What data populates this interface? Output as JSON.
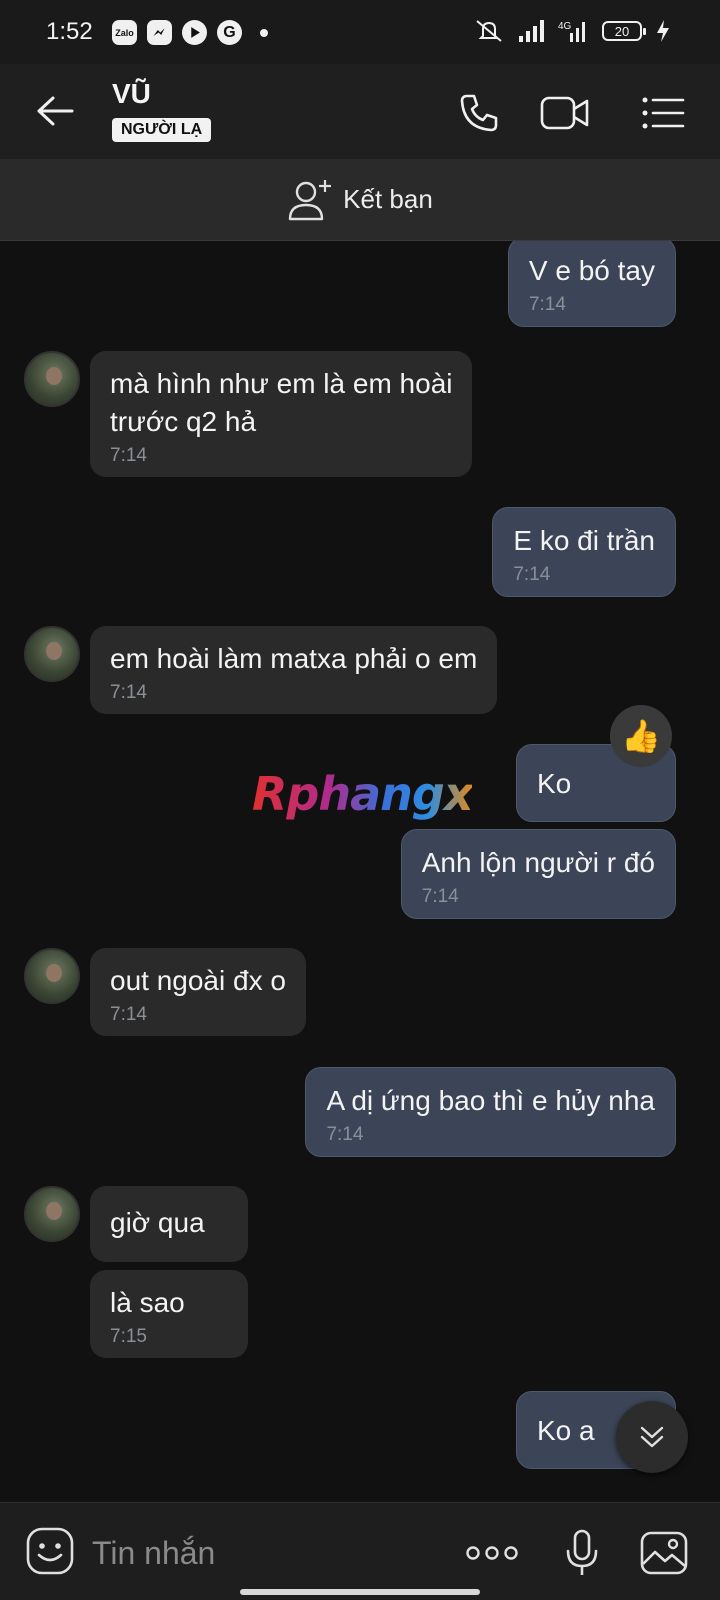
{
  "status_bar": {
    "time": "1:52",
    "apps": [
      "Zalo",
      "messenger-app",
      "youtube-app",
      "G"
    ],
    "network": "4G",
    "battery": "20"
  },
  "header": {
    "contact_name": "VŨ",
    "badge": "NGƯỜI LẠ",
    "icons": [
      "back-arrow-icon",
      "phone-icon",
      "video-icon",
      "menu-list-icon"
    ]
  },
  "add_friend": {
    "label": "Kết bạn"
  },
  "messages": [
    {
      "direction": "out",
      "text": "V e bó tay",
      "time": "7:14"
    },
    {
      "direction": "in",
      "text": "mà hình như em là em hoài\ntrước q2 hả",
      "time": "7:14"
    },
    {
      "direction": "out",
      "text": "E ko đi trần",
      "time": "7:14"
    },
    {
      "direction": "in",
      "text": "em hoài làm matxa phải o em",
      "time": "7:14"
    },
    {
      "direction": "out",
      "text": "Ko",
      "time": ""
    },
    {
      "direction": "out",
      "text": "Anh lộn người r đó",
      "time": "7:14"
    },
    {
      "direction": "in",
      "text": "out ngoài đx o",
      "time": "7:14"
    },
    {
      "direction": "out",
      "text": "A dị ứng bao thì e hủy nha",
      "time": "7:14"
    },
    {
      "direction": "in",
      "text": "giờ qua",
      "time": ""
    },
    {
      "direction": "in",
      "text": "là sao",
      "time": "7:15"
    },
    {
      "direction": "out",
      "text": "Ko a",
      "time": ""
    }
  ],
  "reaction": {
    "emoji": "👍"
  },
  "watermark": "Rphangx",
  "composer": {
    "placeholder": "Tin nhắn",
    "icons": [
      "emoji-icon",
      "more-icon",
      "microphone-icon",
      "image-icon"
    ]
  }
}
